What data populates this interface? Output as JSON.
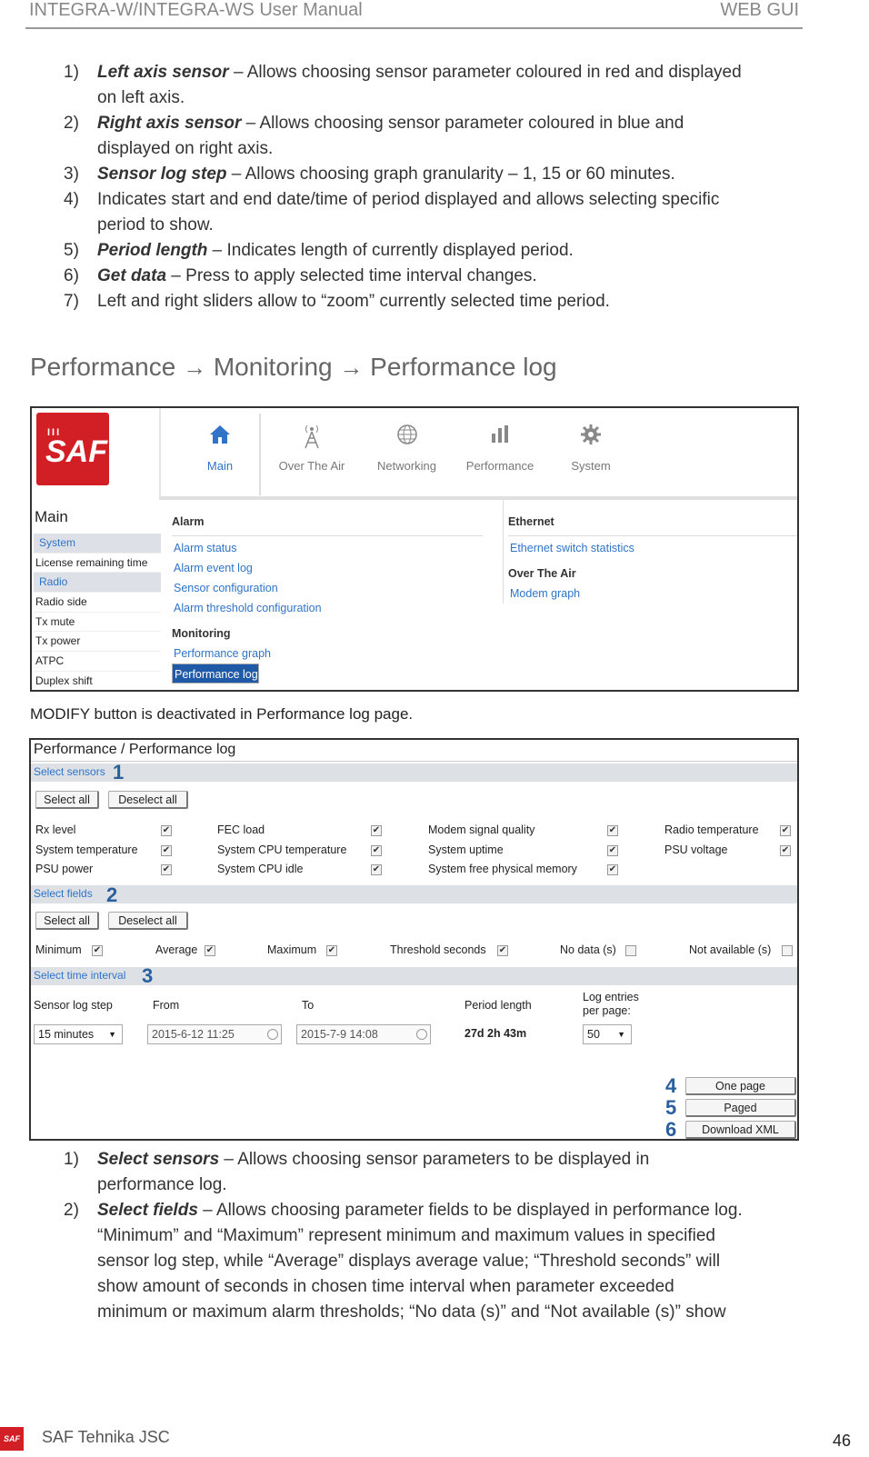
{
  "header": {
    "left": "INTEGRA-W/INTEGRA-WS User Manual",
    "right": "WEB GUI"
  },
  "list1": [
    {
      "num": "1)",
      "term": "Left axis sensor",
      "line1": " – Allows choosing sensor parameter coloured in red and displayed",
      "line2": "on left axis."
    },
    {
      "num": "2)",
      "term": "Right axis sensor",
      "line1": " – Allows choosing sensor parameter coloured in blue and",
      "line2": "displayed on right axis."
    },
    {
      "num": "3)",
      "term": "Sensor log step",
      "line1": " – Allows choosing graph granularity – 1, 15 or 60 minutes.",
      "line2": ""
    },
    {
      "num": "4)",
      "term": "",
      "line1": "Indicates start and end date/time of period displayed and allows selecting specific",
      "line2": "period to show."
    },
    {
      "num": "5)",
      "term": "Period length",
      "line1": " – Indicates length of currently displayed period.",
      "line2": ""
    },
    {
      "num": "6)",
      "term": "Get data",
      "line1": " – Press to apply selected time interval changes.",
      "line2": ""
    },
    {
      "num": "7)",
      "term": "",
      "line1": "Left and right sliders allow to “zoom” currently selected time period.",
      "line2": ""
    }
  ],
  "heading": {
    "p1": "Performance ",
    "arrow": "→",
    "p2": " Monitoring ",
    "p3": " Performance log"
  },
  "shot1": {
    "logo_bars": "III",
    "logo_text": "SAF",
    "tabs": {
      "main": "Main",
      "air": "Over The Air",
      "net": "Networking",
      "perf": "Performance",
      "sys": "System"
    },
    "side_title": "Main",
    "side_rows": [
      "System",
      "License remaining time",
      "Radio",
      "Radio side",
      "Tx mute",
      "Tx power",
      "ATPC",
      "Duplex shift"
    ],
    "col1": {
      "alarm": "Alarm",
      "alarm_links": [
        "Alarm status",
        "Alarm event log",
        "Sensor configuration",
        "Alarm threshold configuration"
      ],
      "monitoring": "Monitoring",
      "mon_links": [
        "Performance graph",
        "Performance log"
      ]
    },
    "col2": {
      "ethernet": "Ethernet",
      "eth_link": "Ethernet switch statistics",
      "ota": "Over The Air",
      "ota_link": "Modem graph"
    }
  },
  "caption": "MODIFY button is deactivated in Performance log page.",
  "shot2": {
    "title": "Performance / Performance log",
    "sec1": "Select sensors",
    "sec2": "Select fields",
    "sec3": "Select time interval",
    "badges": [
      "1",
      "2",
      "3",
      "4",
      "5",
      "6"
    ],
    "select_all": "Select all",
    "deselect_all": "Deselect all",
    "sensors": [
      [
        "Rx level",
        "FEC load",
        "Modem signal quality",
        "Radio temperature"
      ],
      [
        "System temperature",
        "System CPU temperature",
        "System uptime",
        "PSU voltage"
      ],
      [
        "PSU power",
        "System CPU idle",
        "System free physical memory"
      ]
    ],
    "fields": [
      "Minimum",
      "Average",
      "Maximum",
      "Threshold seconds",
      "No data (s)",
      "Not available (s)"
    ],
    "time": {
      "step_label": "Sensor log step",
      "step_value": "15 minutes",
      "from_label": "From",
      "from_value": "2015-6-12 11:25",
      "to_label": "To",
      "to_value": "2015-7-9 14:08",
      "period_label": "Period length",
      "period_value": "27d 2h 43m",
      "entries_label1": "Log entries",
      "entries_label2": "per page:",
      "entries_value": "50"
    },
    "buttons": {
      "one_page": "One page",
      "paged": "Paged",
      "download": "Download XML"
    }
  },
  "list2": [
    {
      "num": "1)",
      "term": "Select sensors",
      "lines": [
        " – Allows choosing sensor parameters to be displayed in",
        "performance log."
      ]
    },
    {
      "num": "2)",
      "term": "Select fields",
      "lines": [
        " – Allows choosing parameter fields to be displayed in performance log.",
        "“Minimum” and “Maximum” represent minimum and maximum values in specified",
        "sensor log step, while “Average” displays average value; “Threshold seconds” will",
        "show amount of seconds in chosen time interval when parameter exceeded",
        "minimum or maximum alarm thresholds; “No data (s)” and “Not available (s)” show"
      ]
    }
  ],
  "footer": {
    "logo": "SAF",
    "company": "SAF Tehnika JSC",
    "page": "46"
  },
  "colors": {
    "brand_red": "#d21f26",
    "link_blue": "#2f74c7",
    "selected_blue": "#1e5aa8"
  }
}
